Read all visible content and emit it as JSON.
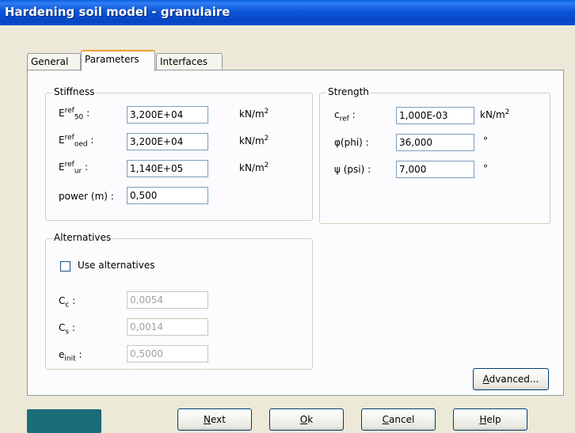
{
  "window": {
    "title": "Hardening soil model - granulaire"
  },
  "tabs": [
    "General",
    "Parameters",
    "Interfaces"
  ],
  "stiffness": {
    "legend": "Stiffness",
    "rows": [
      {
        "label_main": "E",
        "label_sup": "ref",
        "label_sub": "50",
        "colon": ":",
        "value": "3,200E+04",
        "unit": "kN/m",
        "unit_sup": "2"
      },
      {
        "label_main": "E",
        "label_sup": "ref",
        "label_sub": "oed",
        "colon": ":",
        "value": "3,200E+04",
        "unit": "kN/m",
        "unit_sup": "2"
      },
      {
        "label_main": "E",
        "label_sup": "ref",
        "label_sub": "ur",
        "colon": ":",
        "value": "1,140E+05",
        "unit": "kN/m",
        "unit_sup": "2"
      }
    ],
    "power": {
      "label": "power (m) :",
      "value": "0,500"
    }
  },
  "strength": {
    "legend": "Strength",
    "cref": {
      "main": "c",
      "sub": "ref",
      "colon": ":",
      "value": "1,000E-03",
      "unit": "kN/m",
      "unit_sup": "2"
    },
    "phi": {
      "label": "φ(phi) :",
      "value": "36,000",
      "unit": "°"
    },
    "psi": {
      "label": "ψ (psi) :",
      "value": "7,000",
      "unit": "°"
    }
  },
  "alternatives": {
    "legend": "Alternatives",
    "checkbox_label": "Use alternatives",
    "checked": false,
    "cc": {
      "main": "C",
      "sub": "c",
      "colon": ":",
      "value": "0,0054"
    },
    "cs": {
      "main": "C",
      "sub": "s",
      "colon": ":",
      "value": "0,0014"
    },
    "einit": {
      "main": "e",
      "sub": "init",
      "colon": ":",
      "value": "0,5000"
    }
  },
  "buttons": {
    "advanced": {
      "pre": "",
      "u": "A",
      "post": "dvanced..."
    },
    "next": {
      "pre": "",
      "u": "N",
      "post": "ext"
    },
    "ok": {
      "pre": "",
      "u": "O",
      "post": "k"
    },
    "cancel": {
      "pre": "",
      "u": "C",
      "post": "ancel"
    },
    "help": {
      "pre": "",
      "u": "H",
      "post": "elp"
    }
  }
}
